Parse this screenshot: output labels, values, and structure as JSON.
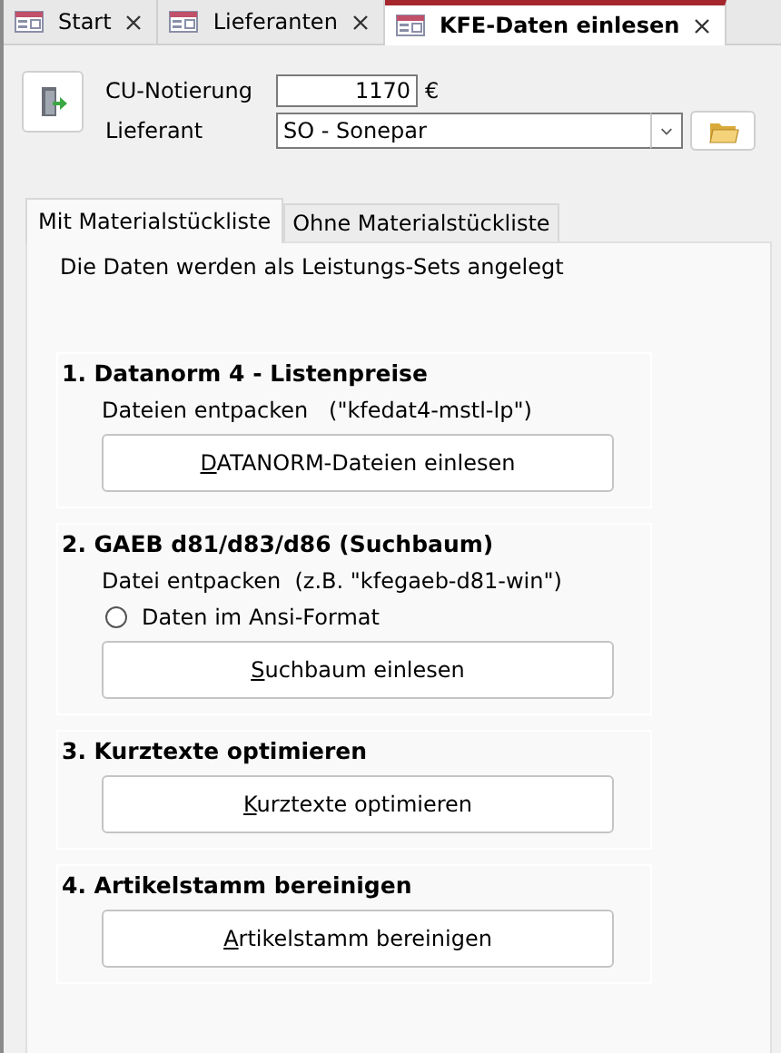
{
  "tabs": [
    {
      "label": "Start",
      "selected": false
    },
    {
      "label": "Lieferanten",
      "selected": false
    },
    {
      "label": "KFE-Daten einlesen",
      "selected": true
    }
  ],
  "form": {
    "cu_label": "CU-Notierung",
    "cu_value": "1170",
    "currency": "€",
    "supplier_label": "Lieferant",
    "supplier_value": "SO - Sonepar"
  },
  "subtabs": [
    {
      "label": "Mit Materialstückliste",
      "selected": true
    },
    {
      "label": "Ohne Materialstückliste",
      "selected": false
    }
  ],
  "intro": "Die Daten werden als Leistungs-Sets angelegt",
  "sections": [
    {
      "heading": "1. Datanorm 4 - Listenpreise",
      "note": "Dateien entpacken   (\"kfedat4-mstl-lp\")",
      "button": "DATANORM-Dateien einlesen"
    },
    {
      "heading": "2. GAEB d81/d83/d86 (Suchbaum)",
      "note": "Datei entpacken  (z.B. \"kfegaeb-d81-win\")",
      "option": {
        "label": "Daten im Ansi-Format",
        "selected": false
      },
      "button": "Suchbaum einlesen"
    },
    {
      "heading": "3. Kurztexte optimieren",
      "button": "Kurztexte optimieren"
    },
    {
      "heading": "4. Artikelstamm bereinigen",
      "button": "Artikelstamm bereinigen"
    }
  ]
}
